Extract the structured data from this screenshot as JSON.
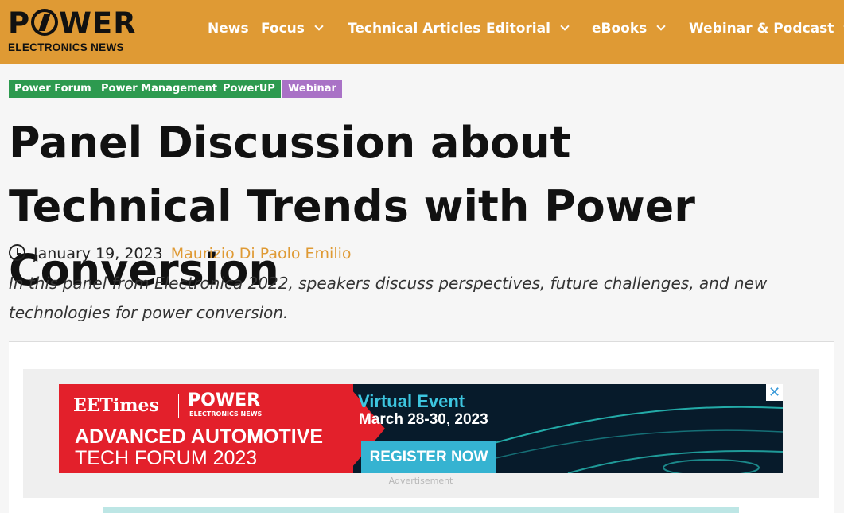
{
  "header": {
    "logo_top": "POWER",
    "logo_bottom": "ELECTRONICS NEWS",
    "nav": [
      {
        "label": "News",
        "has_dropdown": false
      },
      {
        "label": "Focus",
        "has_dropdown": true
      },
      {
        "label": "Technical Articles",
        "has_dropdown": false
      },
      {
        "label": "Editorial",
        "has_dropdown": true
      },
      {
        "label": "eBooks",
        "has_dropdown": true
      },
      {
        "label": "Webinar & Podcast",
        "has_dropdown": true
      }
    ],
    "bg_color": "#df9a34"
  },
  "tags": [
    {
      "label": "Power Forum",
      "color": "#2d9a4f"
    },
    {
      "label": "Power Management",
      "color": "#2d9a4f"
    },
    {
      "label": "PowerUP",
      "color": "#2d9a4f"
    },
    {
      "label": "Webinar",
      "color": "#a972c6"
    }
  ],
  "article": {
    "title": "Panel Discussion about Technical Trends with Power Conversion",
    "date": "January 19, 2023",
    "author": "Maurizio Di Paolo Emilio",
    "dek": "In this panel from Electronica 2022, speakers discuss perspectives, future challenges, and new technologies for power conversion."
  },
  "ad": {
    "eetimes": "EETimes",
    "power": "POWER",
    "power_sub": "ELECTRONICS NEWS",
    "line1": "ADVANCED AUTOMOTIVE",
    "line2": "TECH FORUM 2023",
    "virtual": "Virtual Event",
    "dates": "March 28-30, 2023",
    "cta": "REGISTER NOW",
    "close": "✕",
    "label": "Advertisement"
  }
}
